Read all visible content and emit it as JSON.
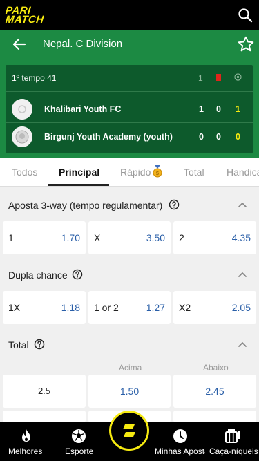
{
  "brand": {
    "line1": "PARI",
    "line2": "MATCH",
    "color": "#f6ea10"
  },
  "header": {
    "title": "Nepal. C Division"
  },
  "match": {
    "time": "1º tempo 41'",
    "col_first": "1",
    "teams": [
      {
        "name": "Khalibari Youth FC",
        "s1": "1",
        "s2": "0",
        "total": "1"
      },
      {
        "name": "Birgunj Youth Academy (youth)",
        "s1": "0",
        "s2": "0",
        "total": "0"
      }
    ]
  },
  "tabs": [
    "Todos",
    "Principal",
    "Rápido",
    "Total",
    "Handicap"
  ],
  "sections": {
    "three_way": {
      "title": "Aposta 3-way (tempo regulamentar)",
      "odds": [
        {
          "label": "1",
          "value": "1.70"
        },
        {
          "label": "X",
          "value": "3.50"
        },
        {
          "label": "2",
          "value": "4.35"
        }
      ]
    },
    "double_chance": {
      "title": "Dupla chance",
      "odds": [
        {
          "label": "1X",
          "value": "1.18"
        },
        {
          "label": "1 or 2",
          "value": "1.27"
        },
        {
          "label": "X2",
          "value": "2.05"
        }
      ]
    },
    "total": {
      "title": "Total",
      "over_label": "Acima",
      "under_label": "Abaixo",
      "line": "2.5",
      "over": "1.50",
      "under": "2.45"
    }
  },
  "nav": [
    "Melhores",
    "Esporte",
    "Minhas Apostas",
    "Caça-níqueis"
  ],
  "colors": {
    "green": "#1c8a43",
    "dark_green": "#0d5a2c",
    "odds_blue": "#2a5fa8",
    "red_card": "#e0251b"
  }
}
